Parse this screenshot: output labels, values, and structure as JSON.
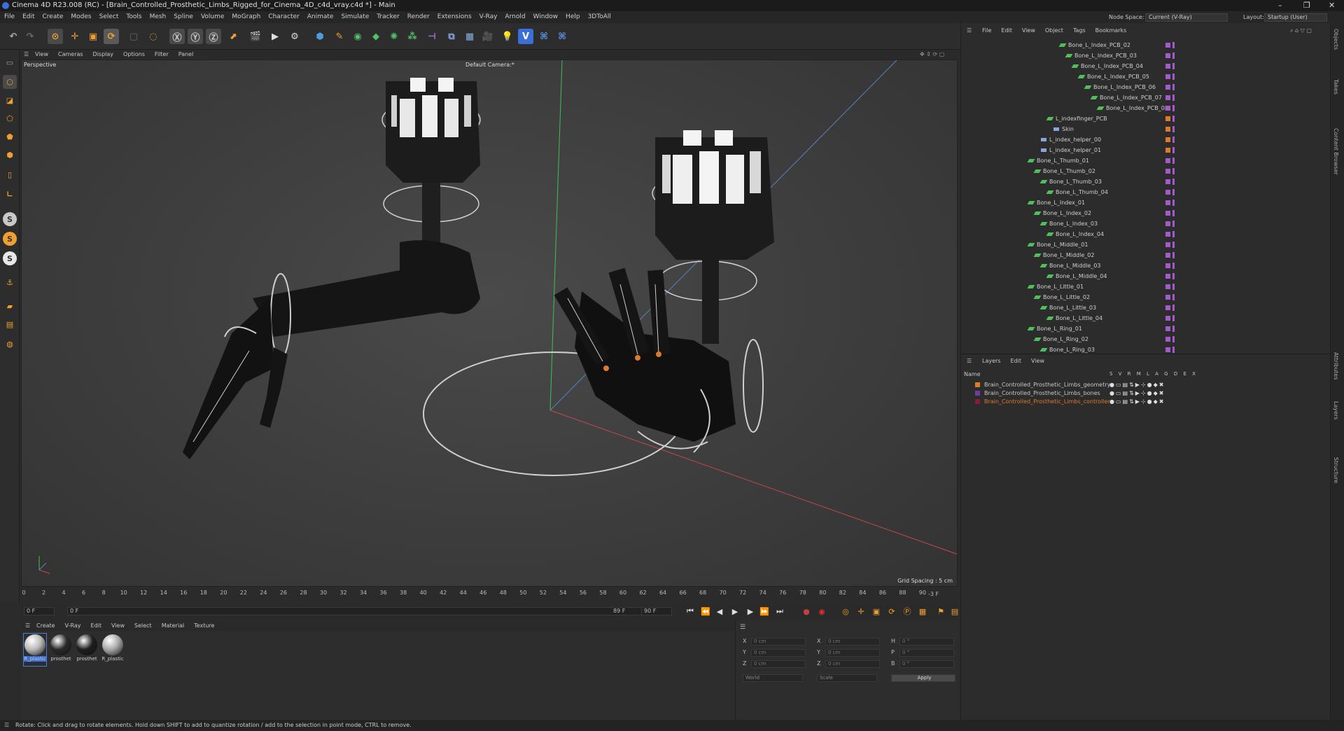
{
  "window": {
    "title": "Cinema 4D R23.008 (RC) - [Brain_Controlled_Prosthetic_Limbs_Rigged_for_Cinema_4D_c4d_vray.c4d *] - Main",
    "controls": [
      "–",
      "❐",
      "✕"
    ]
  },
  "menubar": {
    "items": [
      "File",
      "Edit",
      "Create",
      "Modes",
      "Select",
      "Tools",
      "Mesh",
      "Spline",
      "Volume",
      "MoGraph",
      "Character",
      "Animate",
      "Simulate",
      "Tracker",
      "Render",
      "Extensions",
      "V-Ray",
      "Arnold",
      "Window",
      "Help",
      "3DToAll"
    ],
    "node_space_label": "Node Space:",
    "node_space_value": "Current (V-Ray)",
    "layout_label": "Layout:",
    "layout_value": "Startup (User)"
  },
  "viewport": {
    "menu": [
      "View",
      "Cameras",
      "Display",
      "Options",
      "Filter",
      "Panel"
    ],
    "projection": "Perspective",
    "camera": "Default Camera:*",
    "grid_spacing": "Grid Spacing : 5 cm"
  },
  "timeline": {
    "ticks": [
      "0",
      "2",
      "4",
      "6",
      "8",
      "10",
      "12",
      "14",
      "16",
      "18",
      "20",
      "22",
      "24",
      "26",
      "28",
      "30",
      "32",
      "34",
      "36",
      "38",
      "40",
      "42",
      "44",
      "46",
      "48",
      "50",
      "52",
      "54",
      "56",
      "58",
      "60",
      "62",
      "64",
      "66",
      "68",
      "70",
      "72",
      "74",
      "76",
      "78",
      "80",
      "82",
      "84",
      "86",
      "88",
      "90"
    ],
    "frame_end_marker": "-3 F",
    "current_frame": "0 F",
    "start_frame": "0 F",
    "end_frame_a": "89 F",
    "end_frame_b": "90 F"
  },
  "material_manager": {
    "menu": [
      "Create",
      "V-Ray",
      "Edit",
      "View",
      "Select",
      "Material",
      "Texture"
    ],
    "materials": [
      {
        "label": "R_plastic",
        "color": "#b9b9b9"
      },
      {
        "label": "prosthet",
        "color": "#2a2a2a"
      },
      {
        "label": "prosthet",
        "color": "#1e1e1e"
      },
      {
        "label": "R_plastic",
        "color": "#a8a8a8"
      }
    ]
  },
  "coordinates": {
    "rows": [
      {
        "a": "X",
        "av": "0 cm",
        "b": "X",
        "bv": "0 cm",
        "c": "H",
        "cv": "0 °"
      },
      {
        "a": "Y",
        "av": "0 cm",
        "b": "Y",
        "bv": "0 cm",
        "c": "P",
        "cv": "0 °"
      },
      {
        "a": "Z",
        "av": "0 cm",
        "b": "Z",
        "bv": "0 cm",
        "c": "B",
        "cv": "0 °"
      }
    ],
    "mode": "World",
    "size_mode": "Scale",
    "apply": "Apply"
  },
  "object_manager": {
    "menu": [
      "File",
      "Edit",
      "View",
      "Object",
      "Tags",
      "Bookmarks"
    ],
    "rows": [
      {
        "name": "Bone_L_Index_PCB_02",
        "depth": 9,
        "tag": "#a45acb"
      },
      {
        "name": "Bone_L_Index_PCB_03",
        "depth": 10,
        "tag": "#a45acb"
      },
      {
        "name": "Bone_L_Index_PCB_04",
        "depth": 11,
        "tag": "#a45acb"
      },
      {
        "name": "Bone_L_Index_PCB_05",
        "depth": 12,
        "tag": "#a45acb"
      },
      {
        "name": "Bone_L_Index_PCB_06",
        "depth": 13,
        "tag": "#a45acb"
      },
      {
        "name": "Bone_L_Index_PCB_07",
        "depth": 14,
        "tag": "#a45acb"
      },
      {
        "name": "Bone_L_Index_PCB_08",
        "depth": 15,
        "tag": "#a45acb"
      },
      {
        "name": "L_indexfinger_PCB",
        "depth": 7,
        "tag": "#e07a2a"
      },
      {
        "name": "Skin",
        "depth": 8,
        "tag": "#e07a2a"
      },
      {
        "name": "L_index_helper_00",
        "depth": 6,
        "tag": "#e07a2a"
      },
      {
        "name": "L_index_helper_01",
        "depth": 6,
        "tag": "#e07a2a"
      },
      {
        "name": "Bone_L_Thumb_01",
        "depth": 4,
        "tag": "#a45acb"
      },
      {
        "name": "Bone_L_Thumb_02",
        "depth": 5,
        "tag": "#a45acb"
      },
      {
        "name": "Bone_L_Thumb_03",
        "depth": 6,
        "tag": "#a45acb"
      },
      {
        "name": "Bone_L_Thumb_04",
        "depth": 7,
        "tag": "#a45acb"
      },
      {
        "name": "Bone_L_Index_01",
        "depth": 4,
        "tag": "#a45acb"
      },
      {
        "name": "Bone_L_Index_02",
        "depth": 5,
        "tag": "#a45acb"
      },
      {
        "name": "Bone_L_Index_03",
        "depth": 6,
        "tag": "#a45acb"
      },
      {
        "name": "Bone_L_Index_04",
        "depth": 7,
        "tag": "#a45acb"
      },
      {
        "name": "Bone_L_Middle_01",
        "depth": 4,
        "tag": "#a45acb"
      },
      {
        "name": "Bone_L_Middle_02",
        "depth": 5,
        "tag": "#a45acb"
      },
      {
        "name": "Bone_L_Middle_03",
        "depth": 6,
        "tag": "#a45acb"
      },
      {
        "name": "Bone_L_Middle_04",
        "depth": 7,
        "tag": "#a45acb"
      },
      {
        "name": "Bone_L_Little_01",
        "depth": 4,
        "tag": "#a45acb"
      },
      {
        "name": "Bone_L_Little_02",
        "depth": 5,
        "tag": "#a45acb"
      },
      {
        "name": "Bone_L_Little_03",
        "depth": 6,
        "tag": "#a45acb"
      },
      {
        "name": "Bone_L_Little_04",
        "depth": 7,
        "tag": "#a45acb"
      },
      {
        "name": "Bone_L_Ring_01",
        "depth": 4,
        "tag": "#a45acb"
      },
      {
        "name": "Bone_L_Ring_02",
        "depth": 5,
        "tag": "#a45acb"
      },
      {
        "name": "Bone_L_Ring_03",
        "depth": 6,
        "tag": "#a45acb"
      }
    ]
  },
  "layer_manager": {
    "menu": [
      "Layers",
      "Edit",
      "View"
    ],
    "col_name": "Name",
    "cols": "S V R M L A G D E X",
    "layers": [
      {
        "name": "Brain_Controlled_Prosthetic_Limbs_geometry",
        "color": "#e07a2a",
        "active": false
      },
      {
        "name": "Brain_Controlled_Prosthetic_Limbs_bones",
        "color": "#6b3fa0",
        "active": false
      },
      {
        "name": "Brain_Controlled_Prosthetic_Limbs_controllers",
        "color": "#8b1a3a",
        "active": true
      }
    ]
  },
  "side_tabs": [
    "Objects",
    "Takes",
    "Content Browser",
    "Attributes",
    "Layers",
    "Structure"
  ],
  "status": "Rotate: Click and drag to rotate elements. Hold down SHIFT to add to quantize rotation / add to the selection in point mode, CTRL to remove.",
  "colors": {
    "accent": "#e07a2a",
    "bone": "#4fbf5a",
    "active_layer": "#e0782a"
  }
}
